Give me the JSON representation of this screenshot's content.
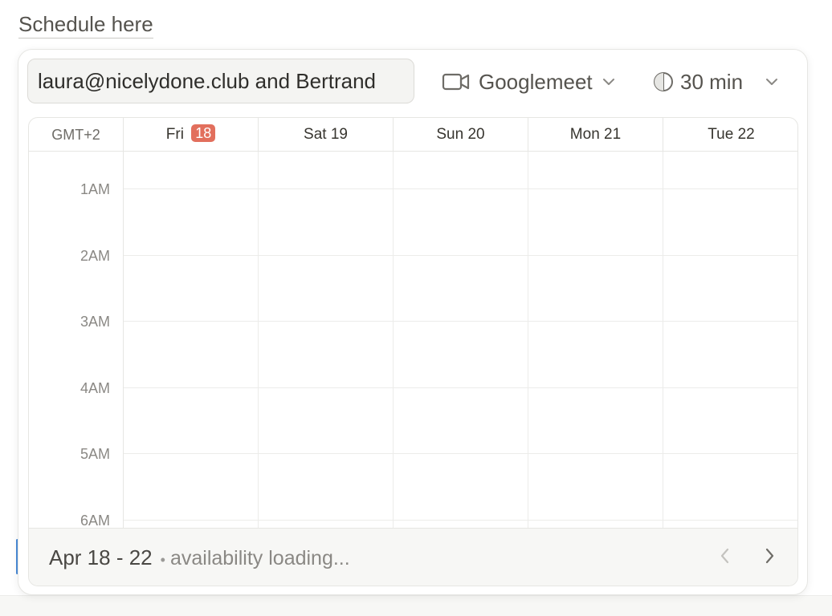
{
  "heading": "Schedule here",
  "invitees": "laura@nicelydone.club and Bertrand",
  "conference": {
    "icon": "video-camera-icon",
    "label": "Googlemeet"
  },
  "duration": {
    "icon": "duration-icon",
    "label": "30 min"
  },
  "calendar": {
    "timezone": "GMT+2",
    "days": [
      {
        "name": "Fri",
        "date": "18",
        "today": true
      },
      {
        "name": "Sat",
        "date": "19",
        "today": false
      },
      {
        "name": "Sun",
        "date": "20",
        "today": false
      },
      {
        "name": "Mon",
        "date": "21",
        "today": false
      },
      {
        "name": "Tue",
        "date": "22",
        "today": false
      }
    ],
    "hours": [
      "1AM",
      "2AM",
      "3AM",
      "4AM",
      "5AM",
      "6AM"
    ]
  },
  "footer": {
    "range": "Apr 18 - 22",
    "separator": "•",
    "status": "availability loading..."
  },
  "colors": {
    "today_badge": "#e26f5d",
    "accent": "#4a8ad6"
  }
}
